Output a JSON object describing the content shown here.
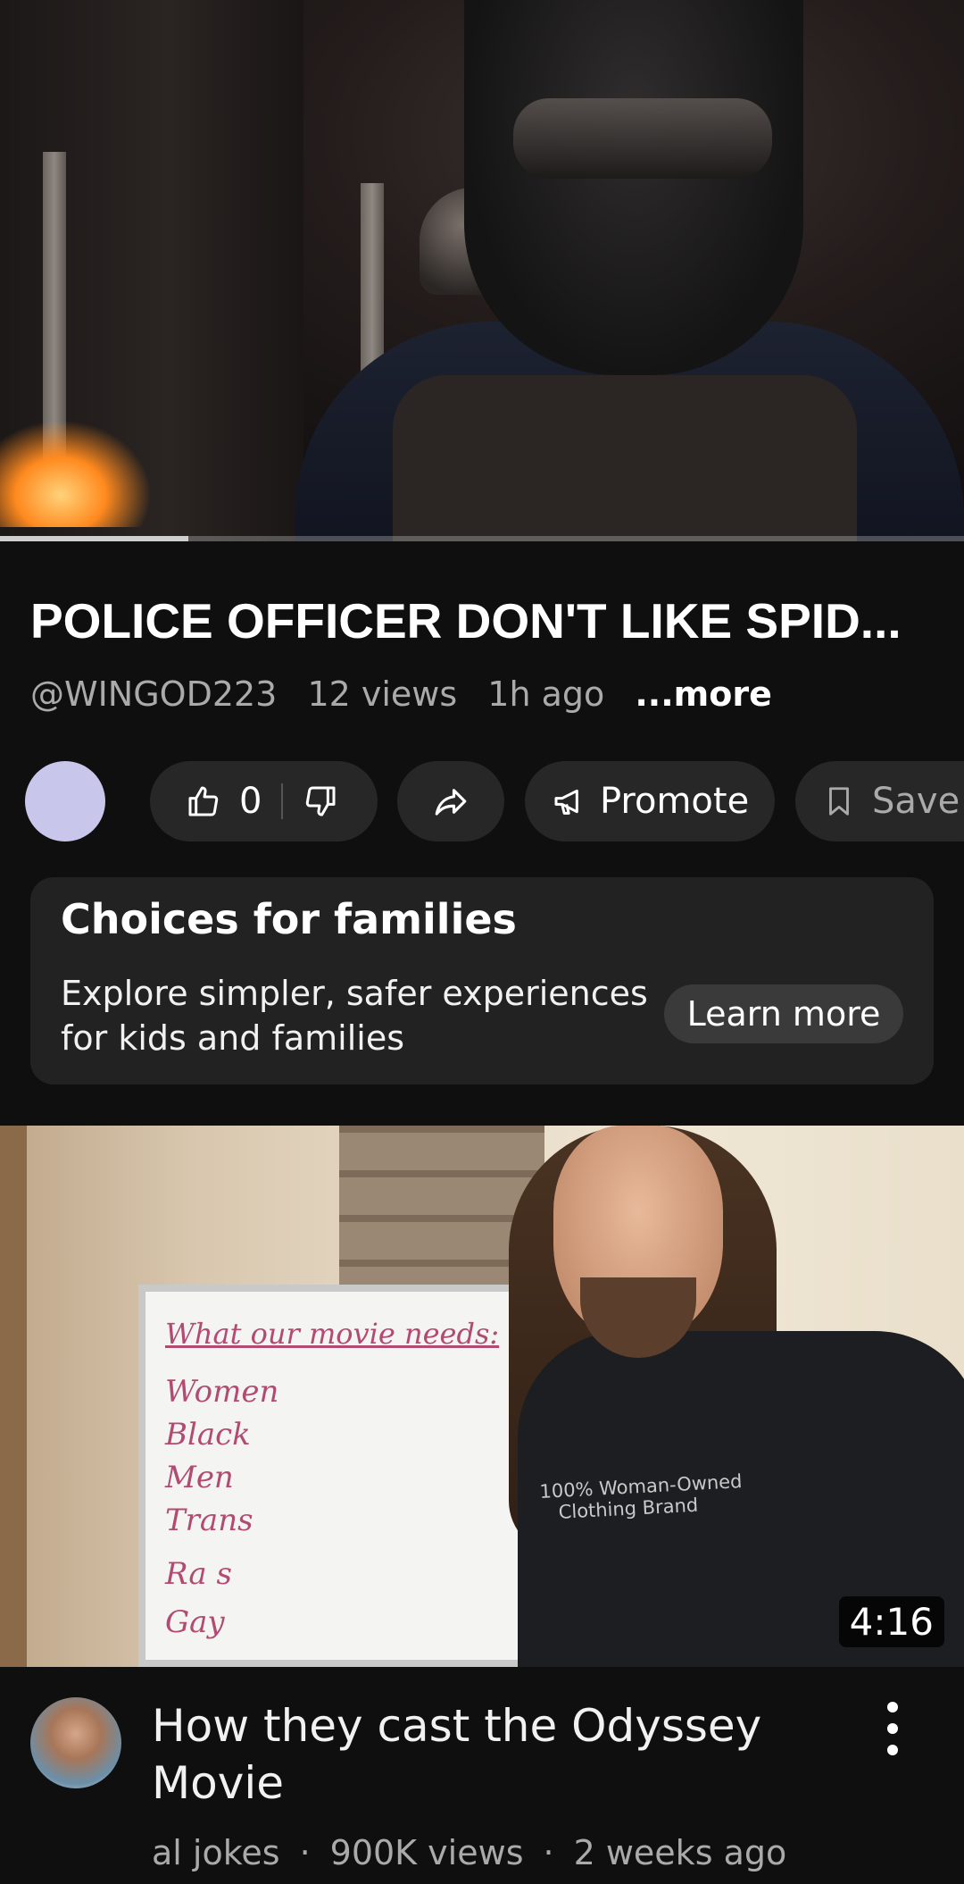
{
  "player": {
    "progress_fraction": 0.195
  },
  "video": {
    "title": "POLICE OFFICER DON'T LIKE SPID...",
    "channel": "@WINGOD223",
    "views": "12 views",
    "age": "1h ago",
    "more_label": "...more"
  },
  "actions": {
    "like_count": "0",
    "promote_label": "Promote",
    "save_label": "Save"
  },
  "promo_card": {
    "title": "Choices for families",
    "description": "Explore simpler, safer experiences for kids and families",
    "button_label": "Learn more"
  },
  "next_video": {
    "duration": "4:16",
    "title": "How they cast the Odyssey Movie",
    "channel": "al jokes",
    "views": "900K views",
    "age": "2 weeks ago",
    "thumbnail_board": {
      "heading": "What our movie needs:",
      "lines": [
        "Women",
        "Black",
        "Men",
        "Trans",
        "Ra   s",
        "Gay"
      ]
    },
    "thumbnail_shirt_text": [
      "100% Woman-Owned",
      "Clothing Brand"
    ]
  },
  "colors": {
    "background": "#0f0f0f",
    "pill": "#272727",
    "card": "#222222",
    "secondary_text": "#aaaaaa"
  }
}
